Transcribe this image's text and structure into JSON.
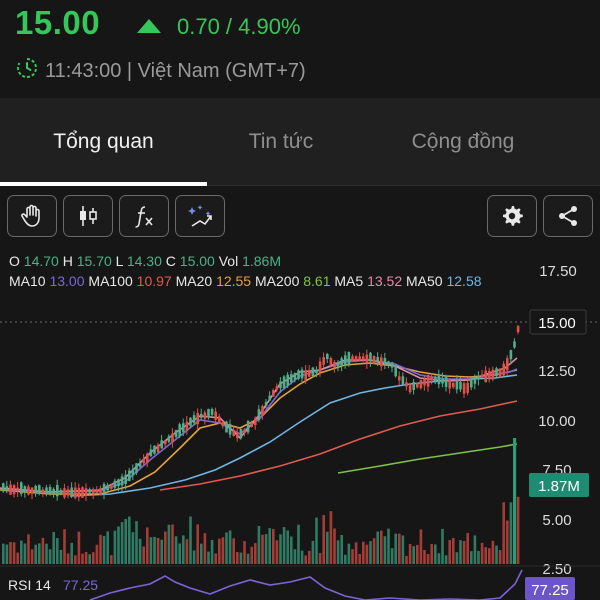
{
  "header": {
    "price": "15.00",
    "change": "0.70 / 4.90%",
    "timestamp": "11:43:00 | Việt Nam (GMT+7)"
  },
  "tabs": [
    "Tổng quan",
    "Tin tức",
    "Cộng đồng"
  ],
  "toolbar": {
    "left_icons": [
      "hand-icon",
      "candlestick-icon",
      "function-icon",
      "magic-wand-icon"
    ],
    "right_icons": [
      "gear-icon",
      "share-icon"
    ]
  },
  "ohlc": {
    "o_label": "O",
    "o": "14.70",
    "h_label": "H",
    "h": "15.70",
    "l_label": "L",
    "l": "14.30",
    "c_label": "C",
    "c": "15.00",
    "vol_label": "Vol",
    "vol": "1.86M"
  },
  "ma": {
    "ma10_label": "MA10",
    "ma10": "13.00",
    "ma100_label": "MA100",
    "ma100": "10.97",
    "ma20_label": "MA20",
    "ma20": "12.55",
    "ma200_label": "MA200",
    "ma200": "8.61",
    "ma5_label": "MA5",
    "ma5": "13.52",
    "ma50_label": "MA50",
    "ma50": "12.58"
  },
  "axis": {
    "ticks": [
      "17.50",
      "15.00",
      "12.50",
      "10.00",
      "7.50",
      "5.00",
      "2.50"
    ],
    "price_tag": "15.00",
    "vol_tag": "1.87M"
  },
  "rsi": {
    "label": "RSI 14",
    "value": "77.25",
    "tag": "77.25"
  },
  "colors": {
    "up": "#34c759",
    "candle_up": "#4db08a",
    "candle_down": "#e2504a",
    "ma5": "#e58aa7",
    "ma10": "#7b67d8",
    "ma20": "#e4a23e",
    "ma50": "#6fb6e3",
    "ma100": "#e05a4f",
    "ma200": "#7ec24a",
    "rsi": "#7e63d8",
    "background": "#161616"
  }
}
